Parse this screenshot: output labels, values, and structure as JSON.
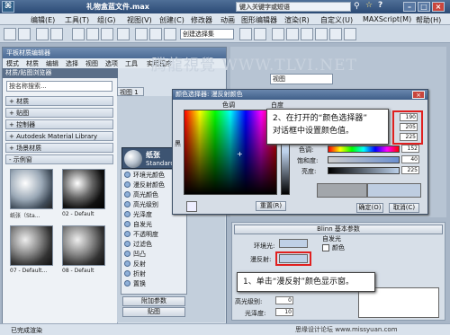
{
  "window": {
    "title": "礼物盒蓝文件.max",
    "search_placeholder": "键入关键字或短语"
  },
  "menu": [
    "编辑(E)",
    "工具(T)",
    "组(G)",
    "视图(V)",
    "创建(C)",
    "修改器",
    "动画",
    "图形编辑器",
    "渲染(R)",
    "自定义(U)",
    "MAXScript(M)",
    "帮助(H)"
  ],
  "toolbar": {
    "selection_set": "创建选择集",
    "view": "视图"
  },
  "watermark": "腾龍視覺 WWW.TLVI.NET",
  "material_editor": {
    "title": "平板材质编辑器",
    "menu": [
      "模式",
      "材质",
      "编辑",
      "选择",
      "视图",
      "选项",
      "工具",
      "实用程序"
    ],
    "view_tab": "视图 1",
    "browser": {
      "title": "材质/贴图浏览器",
      "search": "按名称搜索...",
      "groups": [
        "材质",
        "贴图",
        "控制器",
        "Autodesk Material Library",
        "场景材质",
        "示例窗"
      ],
      "thumbs": [
        {
          "label": "纸张（Sta..."
        },
        {
          "label": "02 - Default"
        },
        {
          "label": "07 - Default..."
        },
        {
          "label": "08 - Default"
        }
      ]
    },
    "node": {
      "name": "纸张",
      "type": "Standard"
    },
    "slots": [
      "环境光颜色",
      "漫反射颜色",
      "高光颜色",
      "高光级别",
      "光泽度",
      "自发光",
      "不透明度",
      "过滤色",
      "凹凸",
      "反射",
      "折射",
      "置换"
    ],
    "slot_footer": [
      "附加参数",
      "贴图"
    ]
  },
  "color_dialog": {
    "title": "颜色选择器: 漫反射颜色",
    "hue_label": "色调",
    "white_label": "白度",
    "black_label": "黑",
    "red_label": "红:",
    "green_label": "绿:",
    "blue_label": "蓝:",
    "hue2": "色调:",
    "sat": "饱和度:",
    "val": "亮度:",
    "values": {
      "red": "190",
      "green": "205",
      "blue": "225",
      "hue": "152",
      "sat": "40",
      "val": "225"
    },
    "buttons": {
      "reset": "重置(R)",
      "ok": "确定(O)",
      "cancel": "取消(C)"
    }
  },
  "blinn": {
    "title": "Blinn 基本参数",
    "ambient": "环境光:",
    "diffuse": "漫反射:",
    "specular": "高光反射:",
    "self_illum": "自发光",
    "color": "颜色",
    "spec_level": "高光级别:",
    "gloss": "光泽度:",
    "spec_level_value": "0",
    "gloss_value": "10"
  },
  "callouts": {
    "step1": "1、单击“漫反射”颜色显示窗。",
    "step2_line1": "2、在打开的“颜色选择器”",
    "step2_line2": "对话框中设置颜色值。"
  },
  "status": {
    "left": "已完成渲染",
    "right": "思缘设计论坛 www.missyuan.com"
  }
}
